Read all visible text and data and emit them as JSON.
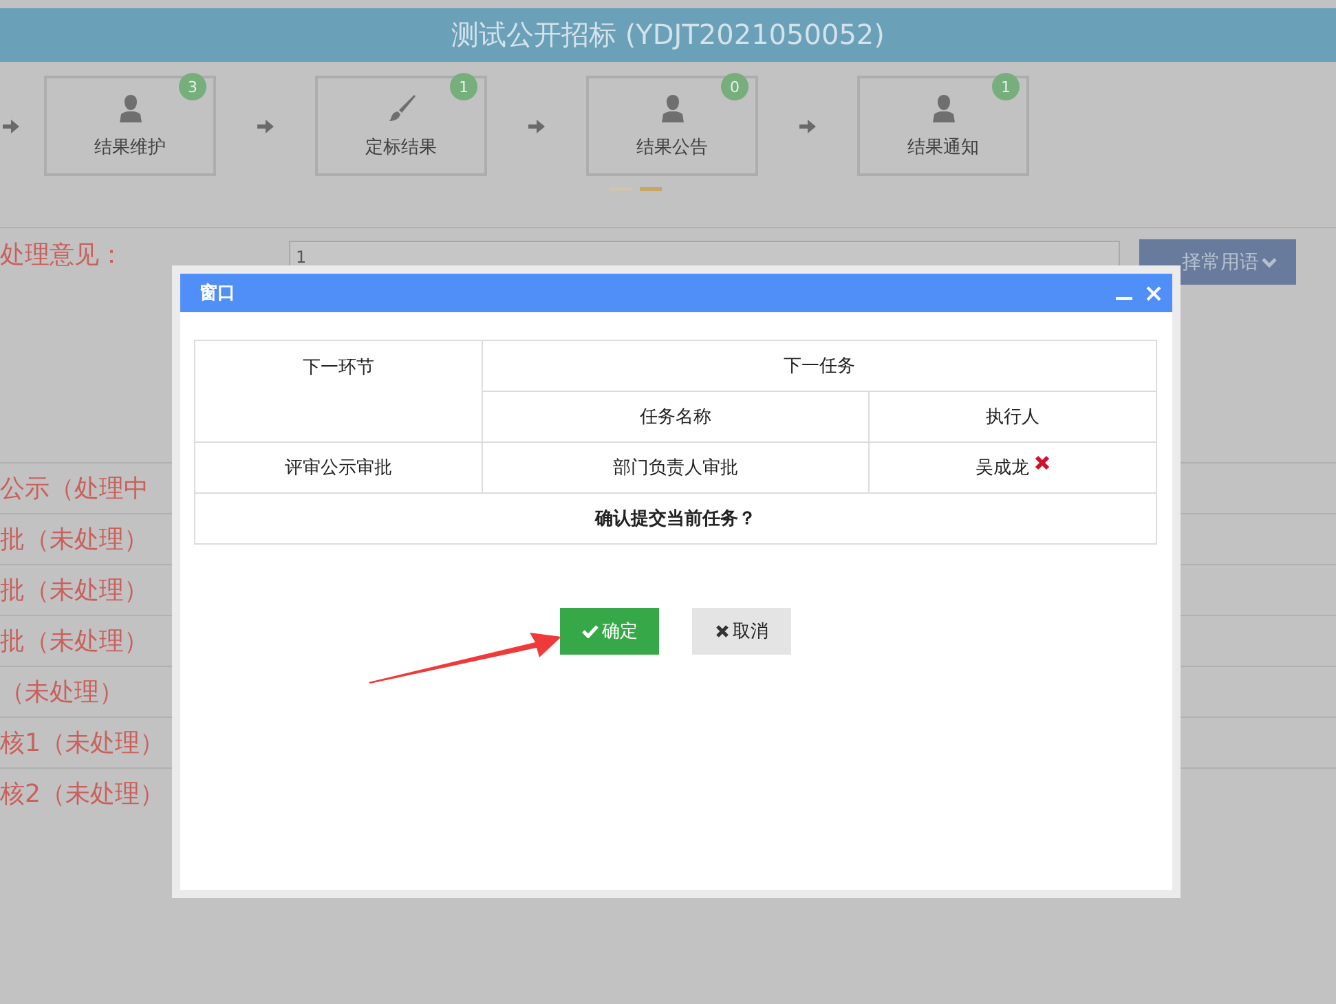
{
  "header": {
    "title": "测试公开招标 (YDJT2021050052)"
  },
  "steps": [
    {
      "label": "结果维护",
      "badge": "3",
      "kind": "person"
    },
    {
      "label": "定标结果",
      "badge": "1",
      "kind": "brush"
    },
    {
      "label": "结果公告",
      "badge": "0",
      "kind": "person"
    },
    {
      "label": "结果通知",
      "badge": "1",
      "kind": "person"
    }
  ],
  "pager": [
    {
      "selected": false
    },
    {
      "selected": true
    }
  ],
  "opinion": {
    "label": "处理意见：",
    "value": "1",
    "phrase_button": "择常用语"
  },
  "tasks": [
    "公示（处理中",
    "批（未处理）",
    "批（未处理）",
    "批（未处理）",
    "（未处理）",
    "核1（未处理）",
    "核2（未处理）"
  ],
  "dialog": {
    "title": "窗口",
    "table": {
      "next_step_header": "下一环节",
      "next_task_header": "下一任务",
      "task_name_header": "任务名称",
      "executor_header": "执行人",
      "row": {
        "next_step": "评审公示审批",
        "task_name": "部门负责人审批",
        "executor": "吴成龙"
      },
      "confirm": "确认提交当前任务？"
    },
    "buttons": [
      {
        "label": "确定",
        "kind": "confirm"
      },
      {
        "label": "取消",
        "kind": "cancel"
      }
    ]
  }
}
